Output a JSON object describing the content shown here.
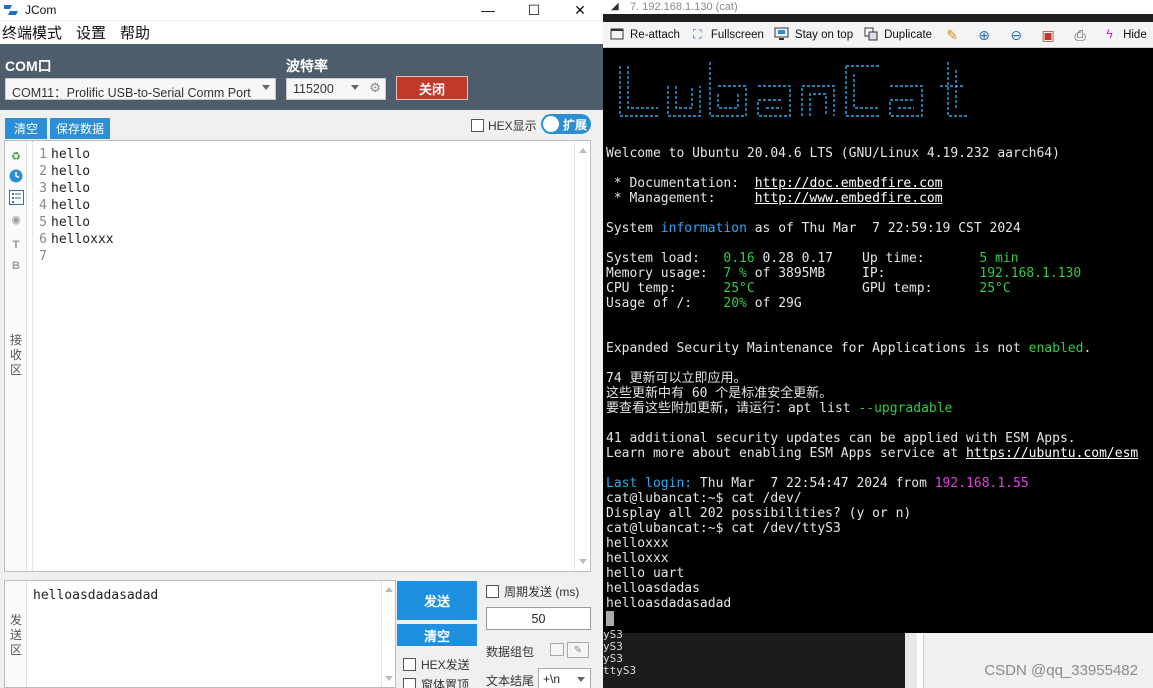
{
  "jcom": {
    "title": "JCom",
    "menu": [
      "终端模式",
      "设置",
      "帮助"
    ],
    "com_label": "COM口",
    "com_value": "COM11：Prolific USB-to-Serial Comm Port",
    "baud_label": "波特率",
    "baud_value": "115200",
    "close_label": "关闭",
    "clear_label": "清空",
    "save_label": "保存数据",
    "hex_display_label": "HEX显示",
    "expand_label": "扩展",
    "recv_label": "接收区",
    "recv_lines": [
      {
        "num": "1",
        "text": "hello"
      },
      {
        "num": "2",
        "text": "hello"
      },
      {
        "num": "3",
        "text": "hello"
      },
      {
        "num": "4",
        "text": "hello"
      },
      {
        "num": "5",
        "text": "hello"
      },
      {
        "num": "6",
        "text": "helloxxx"
      },
      {
        "num": "7",
        "text": ""
      }
    ],
    "send_label": "发送区",
    "send_text": "helloasdadasadad",
    "send_button": "发送",
    "clear_send_button": "清空",
    "period_send_label": "周期发送 (ms)",
    "period_value": "50",
    "hex_send_label": "HEX发送",
    "packet_label": "数据组包",
    "topmost_label": "窗体置顶",
    "eol_label": "文本结尾",
    "eol_value": "+\\n"
  },
  "terminal": {
    "title": "7. 192.168.1.130 (cat)",
    "toolbar": [
      "Re-attach",
      "Fullscreen",
      "Stay on top",
      "Duplicate",
      "Hide"
    ],
    "banner_text": "LubanCat",
    "welcome": "Welcome to Ubuntu 20.04.6 LTS (GNU/Linux 4.19.232 aarch64)",
    "doc_label": " * Documentation:  ",
    "doc_url": "http://doc.embedfire.com",
    "mgmt_label": " * Management:     ",
    "mgmt_url": "http://www.embedfire.com",
    "sysinfo_pre": "System ",
    "sysinfo_word": "information",
    "sysinfo_post": " as of Thu Mar  7 22:59:19 CST 2024",
    "stats": [
      {
        "label": "System load:   ",
        "value": "0.16",
        "rest": " 0.28 0.17",
        "label2": "Up time:       ",
        "value2": "5 min"
      },
      {
        "label": "Memory usage:  ",
        "value": "7 %",
        "rest": " of 3895MB",
        "label2": "IP:            ",
        "value2": "192.168.1.130"
      },
      {
        "label": "CPU temp:      ",
        "value": "25°C",
        "rest": "",
        "label2": "GPU temp:      ",
        "value2": "25°C"
      },
      {
        "label": "Usage of /:    ",
        "value": "20%",
        "rest": " of 29G",
        "label2": "",
        "value2": ""
      }
    ],
    "esm_pre": "Expanded Security Maintenance for Applications is not ",
    "esm_word": "enabled",
    "esm_post": ".",
    "updates_1": "74 更新可以立即应用。",
    "updates_2": "这些更新中有 60 个是标准安全更新。",
    "updates_3_pre": "要查看这些附加更新，请运行：apt list ",
    "updates_3_opt": "--upgradable",
    "esm_apps_1": "41 additional security updates can be applied with ESM Apps.",
    "esm_apps_2_pre": "Learn more about enabling ESM Apps service at ",
    "esm_apps_2_url": "https://ubuntu.com/esm",
    "last_login_label": "Last login:",
    "last_login_text": " Thu Mar  7 22:54:47 2024 from ",
    "last_login_ip": "192.168.1.55",
    "session": [
      "cat@lubancat:~$ cat /dev/",
      "Display all 202 possibilities? (y or n)",
      "cat@lubancat:~$ cat /dev/ttyS3",
      "helloxxx",
      "helloxxx",
      "hello uart",
      "helloasdadas",
      "helloasdadasadad"
    ],
    "under_lines": [
      "yS3",
      "yS3",
      "yS3",
      "ttyS3"
    ]
  },
  "watermark": "CSDN @qq_33955482",
  "colors": {
    "config_bg": "#4e5d6c",
    "accent": "#2a8fd4",
    "close_red": "#c0392b",
    "term_green": "#2ecc40",
    "term_cyan": "#2aa9f0",
    "term_magenta": "#e33fe8"
  }
}
